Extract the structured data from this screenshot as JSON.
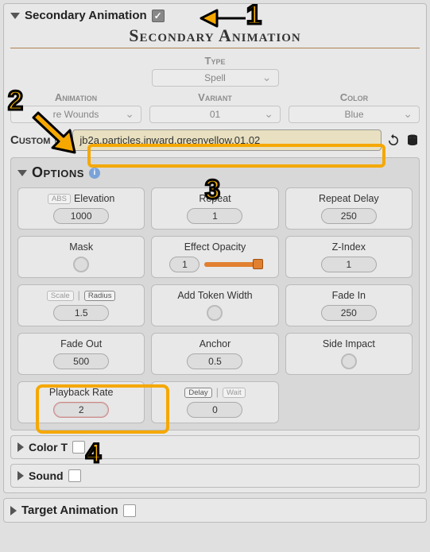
{
  "sections": {
    "secondary": {
      "label": "Secondary Animation",
      "checked": true,
      "banner": "Secondary Animation"
    },
    "target": {
      "label": "Target Animation"
    },
    "color": {
      "label": "Color T"
    },
    "sound": {
      "label": "Sound"
    }
  },
  "type": {
    "label": "Type",
    "value": "Spell"
  },
  "selectors": {
    "animation": {
      "label": "Animation",
      "value": "re Wounds"
    },
    "variant": {
      "label": "Variant",
      "value": "01"
    },
    "color": {
      "label": "Color",
      "value": "Blue"
    }
  },
  "custom": {
    "label": "Custom",
    "checked": true,
    "value": "jb2a.particles.inward.greenyellow.01.02"
  },
  "options": {
    "label": "Options",
    "items": {
      "elevation": {
        "label": "Elevation",
        "badge": "ABS",
        "value": "1000"
      },
      "repeat": {
        "label": "Repeat",
        "value": "1"
      },
      "repeatDelay": {
        "label": "Repeat Delay",
        "value": "250"
      },
      "mask": {
        "label": "Mask"
      },
      "opacity": {
        "label": "Effect Opacity",
        "value": "1"
      },
      "zindex": {
        "label": "Z-Index",
        "value": "1"
      },
      "scaleRadius": {
        "badgeA": "Scale",
        "badgeB": "Radius",
        "value": "1.5"
      },
      "tokenWidth": {
        "label": "Add Token Width"
      },
      "fadeIn": {
        "label": "Fade In",
        "value": "250"
      },
      "fadeOut": {
        "label": "Fade Out",
        "value": "500"
      },
      "anchor": {
        "label": "Anchor",
        "value": "0.5"
      },
      "sideImpact": {
        "label": "Side Impact"
      },
      "playback": {
        "label": "Playback Rate",
        "value": "2"
      },
      "delayWait": {
        "badgeA": "Delay",
        "badgeB": "Wait",
        "value": "0"
      }
    }
  },
  "callouts": {
    "c1": "1",
    "c2": "2",
    "c3": "3",
    "c4": "4"
  }
}
